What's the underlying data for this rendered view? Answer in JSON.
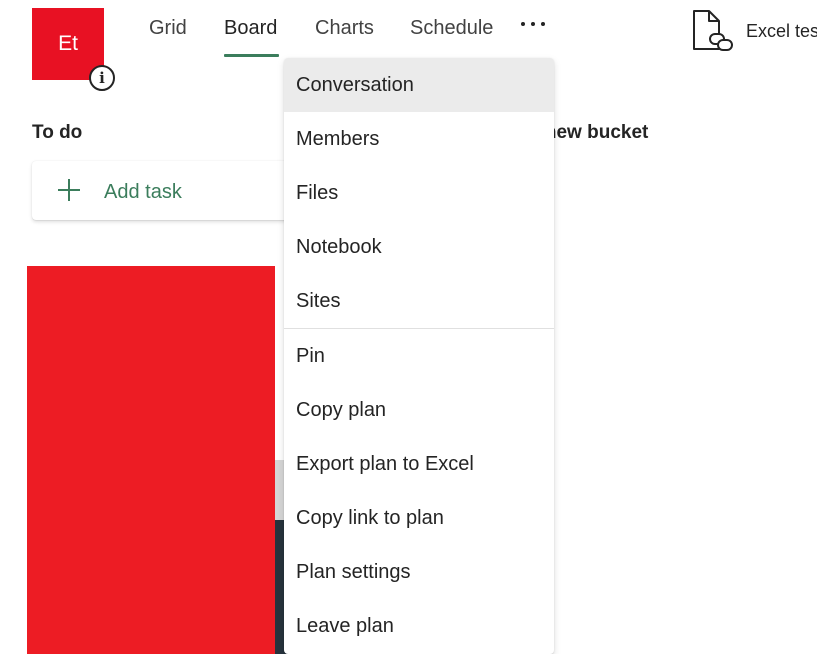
{
  "plan": {
    "avatar_initials": "Et"
  },
  "nav": {
    "tabs": [
      {
        "label": "Grid"
      },
      {
        "label": "Board"
      },
      {
        "label": "Charts"
      },
      {
        "label": "Schedule"
      }
    ],
    "active_tab": "Board",
    "more_icon": "more-horizontal-icon"
  },
  "header": {
    "file_label": "Excel tes",
    "file_icon": "file-link-icon"
  },
  "board": {
    "bucket_title": "To do",
    "add_task_label": "Add task",
    "add_bucket_label": "d new bucket"
  },
  "menu": {
    "items": [
      {
        "label": "Conversation"
      },
      {
        "label": "Members"
      },
      {
        "label": "Files"
      },
      {
        "label": "Notebook"
      },
      {
        "label": "Sites"
      },
      {
        "label": "Pin"
      },
      {
        "label": "Copy plan"
      },
      {
        "label": "Export plan to Excel"
      },
      {
        "label": "Copy link to plan"
      },
      {
        "label": "Plan settings"
      },
      {
        "label": "Leave plan"
      }
    ]
  },
  "colors": {
    "avatar": "#e81123",
    "accent_green": "#3b7d5c",
    "menu_hover": "#ebebeb",
    "redaction": "#ed1c24"
  }
}
